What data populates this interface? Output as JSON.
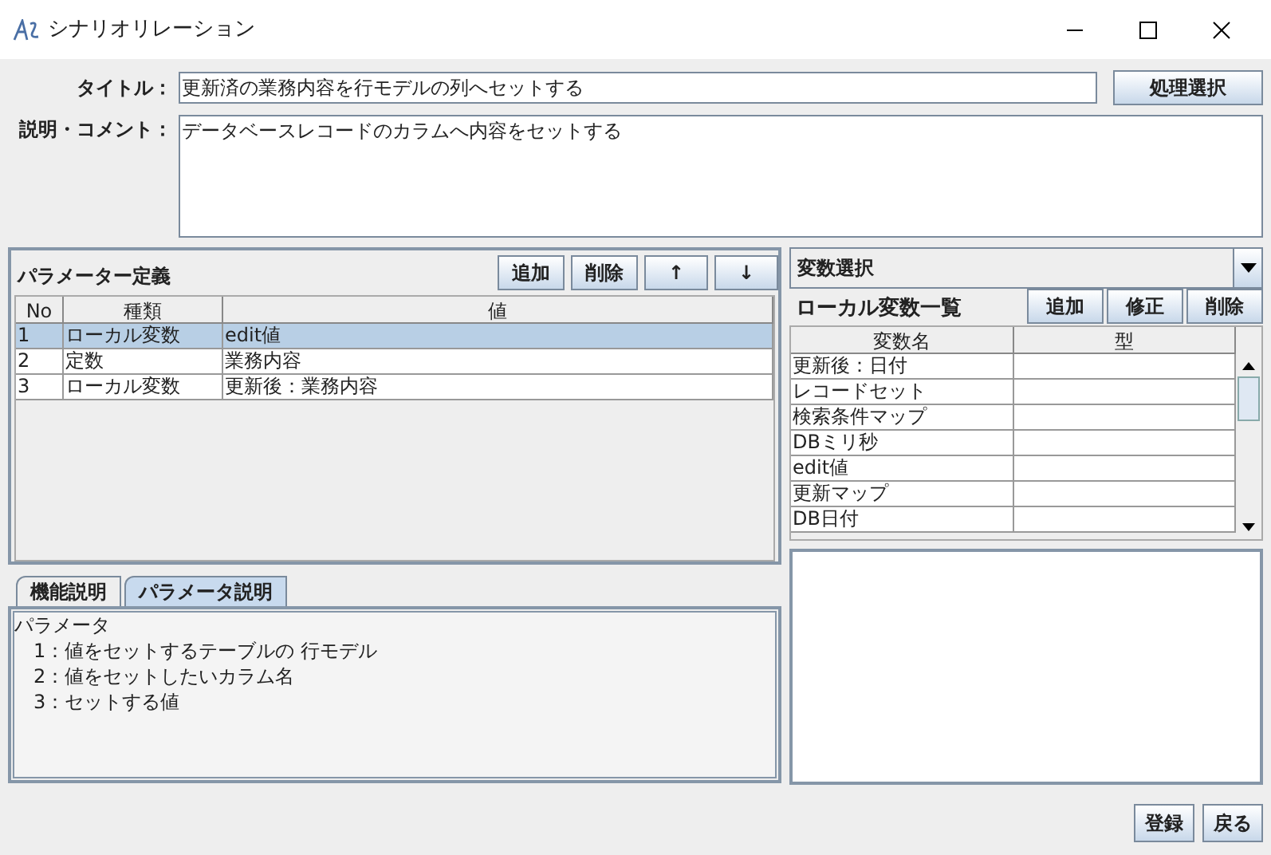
{
  "window": {
    "title": "シナリオリレーション"
  },
  "form": {
    "title_label": "タイトル：",
    "title_value": "更新済の業務内容を行モデルの列へセットする",
    "select_button": "処理選択",
    "comment_label": "説明・コメント：",
    "comment_value": "データベースレコードのカラムへ内容をセットする"
  },
  "parameters": {
    "heading": "パラメーター定義",
    "buttons": [
      "追加",
      "削除",
      "↑",
      "↓"
    ],
    "columns": [
      "No",
      "種類",
      "値"
    ],
    "rows": [
      {
        "cells": [
          "1",
          "ローカル変数",
          "edit値"
        ],
        "selected": true
      },
      {
        "cells": [
          "2",
          "定数",
          "業務内容"
        ],
        "selected": false
      },
      {
        "cells": [
          "3",
          "ローカル変数",
          "更新後：業務内容"
        ],
        "selected": false
      }
    ]
  },
  "help": {
    "tabs": [
      {
        "label": "機能説明",
        "selected": false
      },
      {
        "label": "パラメータ説明",
        "selected": true
      }
    ],
    "heading": "パラメータ",
    "items": [
      "1：値をセットするテーブルの 行モデル",
      "2：値をセットしたいカラム名",
      "3：セットする値"
    ]
  },
  "variables": {
    "dropdown": "変数選択",
    "heading": "ローカル変数一覧",
    "buttons": [
      "追加",
      "修正",
      "削除"
    ],
    "columns": [
      "変数名",
      "型"
    ],
    "rows": [
      {
        "name": "更新後：日付"
      },
      {
        "name": "レコードセット"
      },
      {
        "name": "検索条件マップ"
      },
      {
        "name": "DBミリ秒"
      },
      {
        "name": "edit値"
      },
      {
        "name": "更新マップ"
      },
      {
        "name": "DB日付"
      }
    ]
  },
  "footer": {
    "buttons": [
      "登録",
      "戻る"
    ]
  }
}
